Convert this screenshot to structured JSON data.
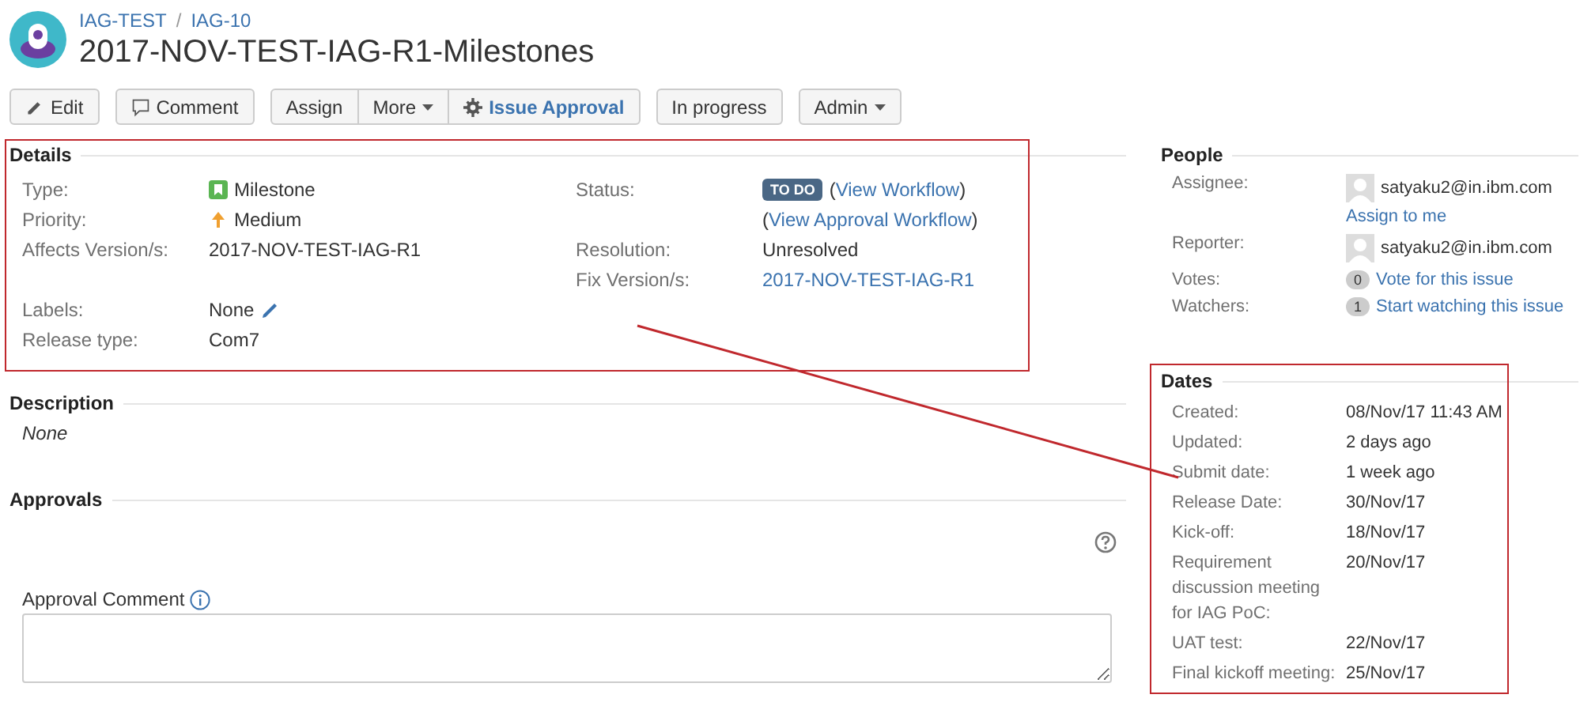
{
  "header": {
    "breadcrumbs": [
      "IAG-TEST",
      "IAG-10"
    ],
    "separator": "/",
    "title": "2017-NOV-TEST-IAG-R1-Milestones"
  },
  "toolbar": [
    [
      {
        "label": "Edit",
        "kind": "edit"
      }
    ],
    [
      {
        "label": "Comment",
        "kind": "comment"
      }
    ],
    [
      {
        "label": "Assign",
        "kind": "plain"
      },
      {
        "label": "More",
        "kind": "menu"
      },
      {
        "label": "Issue Approval",
        "kind": "approval"
      }
    ],
    [
      {
        "label": "In progress",
        "kind": "plain"
      }
    ],
    [
      {
        "label": "Admin",
        "kind": "menu"
      }
    ]
  ],
  "details": {
    "title": "Details",
    "highlighted": true,
    "left": [
      {
        "label": "Type:",
        "parts": [
          {
            "kind": "milestone",
            "text": "Milestone"
          }
        ]
      },
      {
        "label": "Priority:",
        "parts": [
          {
            "kind": "priority",
            "text": "Medium"
          }
        ]
      },
      {
        "label": "Affects Version/s:",
        "parts": [
          {
            "kind": "text",
            "text": "2017-NOV-TEST-IAG-R1"
          }
        ]
      },
      {
        "label": "Labels:",
        "parts": [
          {
            "kind": "editable",
            "text": "None"
          }
        ]
      },
      {
        "label": "Release type:",
        "parts": [
          {
            "kind": "text",
            "text": "Com7"
          }
        ]
      }
    ],
    "right": [
      {
        "label": "Status:",
        "parts": [
          {
            "kind": "lozenge",
            "text": "TO DO"
          },
          {
            "kind": "link",
            "before": "(",
            "text": "View Workflow",
            "after": ")"
          }
        ]
      },
      {
        "parts": [
          {
            "kind": "link",
            "before": "(",
            "text": "View Approval Workflow",
            "after": ")"
          }
        ]
      },
      {
        "label": "Resolution:",
        "parts": [
          {
            "kind": "text",
            "text": "Unresolved"
          }
        ]
      },
      {
        "label": "Fix Version/s:",
        "parts": [
          {
            "kind": "link",
            "text": "2017-NOV-TEST-IAG-R1"
          }
        ]
      }
    ]
  },
  "description": {
    "title": "Description",
    "text": "None"
  },
  "approvals": {
    "title": "Approvals",
    "comment_label": "Approval Comment"
  },
  "people": {
    "title": "People",
    "rows": [
      {
        "label": "Assignee:",
        "kind": "user",
        "value": "satyaku2@in.ibm.com",
        "action": "Assign to me"
      },
      {
        "label": "Reporter:",
        "kind": "user",
        "value": "satyaku2@in.ibm.com"
      },
      {
        "label": "Votes:",
        "kind": "count",
        "count": "0",
        "value": "Vote for this issue"
      },
      {
        "label": "Watchers:",
        "kind": "count",
        "count": "1",
        "value": "Start watching this issue"
      }
    ]
  },
  "dates": {
    "title": "Dates",
    "highlighted": true,
    "rows": [
      {
        "label": "Created:",
        "value": "08/Nov/17 11:43 AM"
      },
      {
        "label": "Updated:",
        "value": "2 days ago"
      },
      {
        "label": "Submit date:",
        "value": "1 week ago"
      },
      {
        "label": "Release Date:",
        "value": "30/Nov/17"
      },
      {
        "label": "Kick-off:",
        "value": "18/Nov/17"
      },
      {
        "label": "Requirement discussion meeting for IAG PoC:",
        "value": "20/Nov/17"
      },
      {
        "label": "UAT test:",
        "value": "22/Nov/17"
      },
      {
        "label": "Final kickoff meeting:",
        "value": "25/Nov/17"
      }
    ]
  },
  "annotation": {
    "kind": "line"
  }
}
